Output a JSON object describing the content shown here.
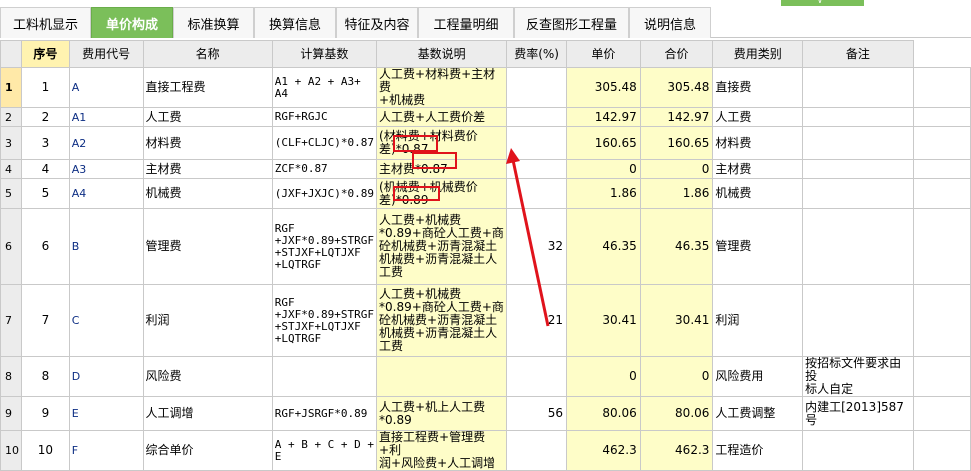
{
  "tabs": [
    {
      "label": "工料机显示",
      "active": false
    },
    {
      "label": "单价构成",
      "active": true
    },
    {
      "label": "标准换算",
      "active": false
    },
    {
      "label": "换算信息",
      "active": false
    },
    {
      "label": "特征及内容",
      "active": false
    },
    {
      "label": "工程量明细",
      "active": false
    },
    {
      "label": "反查图形工程量",
      "active": false
    },
    {
      "label": "说明信息",
      "active": false
    }
  ],
  "columns": [
    "序号",
    "费用代号",
    "名称",
    "计算基数",
    "基数说明",
    "费率(%)",
    "单价",
    "合价",
    "费用类别",
    "备注"
  ],
  "rows": [
    {
      "num": "1",
      "seq": "1",
      "code": "A",
      "name": "直接工程费",
      "base": "A1 + A2 + A3+ A4",
      "desc": "人工费+材料费+主材费\n+机械费",
      "rate": "",
      "price": "305.48",
      "total": "305.48",
      "type": "直接费",
      "note": ""
    },
    {
      "num": "2",
      "seq": "2",
      "code": "A1",
      "name": "人工费",
      "base": "RGF+RGJC",
      "desc": "人工费+人工费价差",
      "rate": "",
      "price": "142.97",
      "total": "142.97",
      "type": "人工费",
      "note": ""
    },
    {
      "num": "3",
      "seq": "3",
      "code": "A2",
      "name": "材料费",
      "base": "(CLF+CLJC)*0.87",
      "desc": "(材料费+材料费价\n差)*0.87",
      "rate": "",
      "price": "160.65",
      "total": "160.65",
      "type": "材料费",
      "note": ""
    },
    {
      "num": "4",
      "seq": "4",
      "code": "A3",
      "name": "主材费",
      "base": "ZCF*0.87",
      "desc": "主材费*0.87",
      "rate": "",
      "price": "0",
      "total": "0",
      "type": "主材费",
      "note": ""
    },
    {
      "num": "5",
      "seq": "5",
      "code": "A4",
      "name": "机械费",
      "base": "(JXF+JXJC)*0.89",
      "desc": "(机械费+机械费价\n差)*0.89",
      "rate": "",
      "price": "1.86",
      "total": "1.86",
      "type": "机械费",
      "note": ""
    },
    {
      "num": "6",
      "seq": "6",
      "code": "B",
      "name": "管理费",
      "base": "RGF\n+JXF*0.89+STRGF\n+STJXF+LQTJXF\n+LQTRGF",
      "desc": "人工费+机械费\n*0.89+商砼人工费+商\n砼机械费+沥青混凝土\n机械费+沥青混凝土人\n工费",
      "rate": "32",
      "price": "46.35",
      "total": "46.35",
      "type": "管理费",
      "note": ""
    },
    {
      "num": "7",
      "seq": "7",
      "code": "C",
      "name": "利润",
      "base": "RGF\n+JXF*0.89+STRGF\n+STJXF+LQTJXF\n+LQTRGF",
      "desc": "人工费+机械费\n*0.89+商砼人工费+商\n砼机械费+沥青混凝土\n机械费+沥青混凝土人\n工费",
      "rate": "21",
      "price": "30.41",
      "total": "30.41",
      "type": "利润",
      "note": ""
    },
    {
      "num": "8",
      "seq": "8",
      "code": "D",
      "name": "风险费",
      "base": "",
      "desc": "",
      "rate": "",
      "price": "0",
      "total": "0",
      "type": "风险费用",
      "note": "按招标文件要求由投\n标人自定"
    },
    {
      "num": "9",
      "seq": "9",
      "code": "E",
      "name": "人工调增",
      "base": "RGF+JSRGF*0.89",
      "desc": "人工费+机上人工费\n*0.89",
      "rate": "56",
      "price": "80.06",
      "total": "80.06",
      "type": "人工费调整",
      "note": "内建工[2013]587号"
    },
    {
      "num": "10",
      "seq": "10",
      "code": "F",
      "name": "综合单价",
      "base": "A + B + C + D +\nE",
      "desc": "直接工程费+管理费+利\n润+风险费+人工调增",
      "rate": "",
      "price": "462.3",
      "total": "462.3",
      "type": "工程造价",
      "note": ""
    }
  ],
  "highlight_color": "#e0131c"
}
